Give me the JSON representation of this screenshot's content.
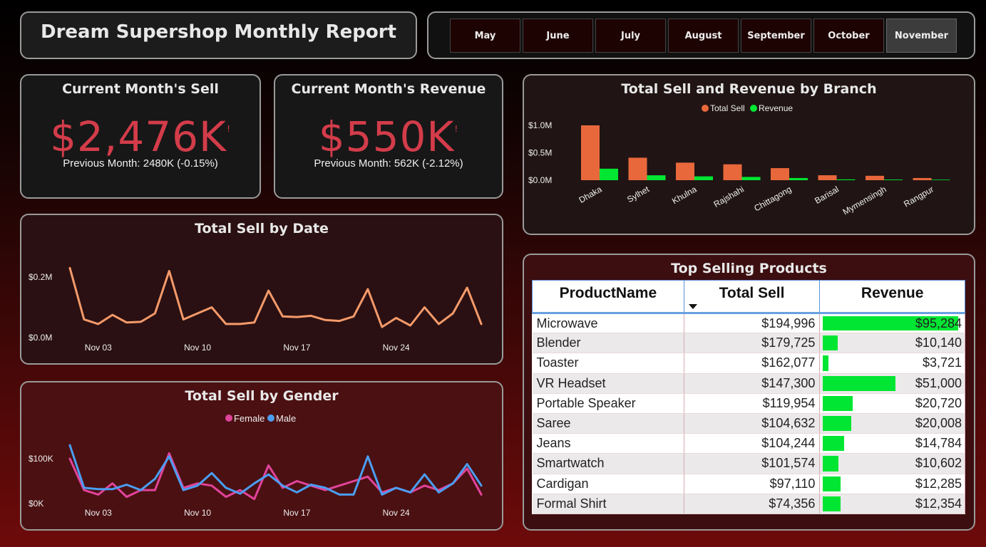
{
  "header": {
    "title": "Dream Supershop Monthly Report"
  },
  "months": [
    {
      "label": "May",
      "active": false
    },
    {
      "label": "June",
      "active": false
    },
    {
      "label": "July",
      "active": false
    },
    {
      "label": "August",
      "active": false
    },
    {
      "label": "September",
      "active": false
    },
    {
      "label": "October",
      "active": false
    },
    {
      "label": "November",
      "active": true
    }
  ],
  "kpis": {
    "sell": {
      "title": "Current Month's Sell",
      "value": "$2,476K",
      "flag": "!",
      "sub": "Previous Month: 2480K (-0.15%)"
    },
    "revenue": {
      "title": "Current Month's Revenue",
      "value": "$550K",
      "flag": "!",
      "sub": "Previous Month: 562K (-2.12%)"
    }
  },
  "colors": {
    "accent_red": "#d33c4a",
    "sell_orange": "#e8683c",
    "revenue_green": "#00e632",
    "line_orange": "#f59a6a",
    "female_pink": "#e0449a",
    "male_blue": "#4a9ef2"
  },
  "charts": {
    "branch": {
      "title": "Total Sell and Revenue by Branch",
      "legend": [
        "Total Sell",
        "Revenue"
      ]
    },
    "date": {
      "title": "Total Sell by Date"
    },
    "gender": {
      "title": "Total Sell by Gender",
      "legend": [
        "Female",
        "Male"
      ]
    }
  },
  "chart_data": [
    {
      "type": "bar",
      "title": "Total Sell and Revenue by Branch",
      "categories": [
        "Dhaka",
        "Sylhet",
        "Khulna",
        "Rajshahi",
        "Chittagong",
        "Barisal",
        "Mymensingh",
        "Rangpur"
      ],
      "series": [
        {
          "name": "Total Sell",
          "values": [
            1.0,
            0.41,
            0.32,
            0.29,
            0.22,
            0.09,
            0.08,
            0.04
          ]
        },
        {
          "name": "Revenue",
          "values": [
            0.21,
            0.09,
            0.07,
            0.06,
            0.04,
            0.015,
            0.012,
            0.01
          ]
        }
      ],
      "ylim": [
        0,
        1.0
      ],
      "yticks": [
        "$0.0M",
        "$0.5M",
        "$1.0M"
      ],
      "legend": "top-center",
      "grid": false
    },
    {
      "type": "line",
      "title": "Total Sell by Date",
      "x": [
        "Nov 01",
        "Nov 02",
        "Nov 03",
        "Nov 04",
        "Nov 05",
        "Nov 06",
        "Nov 07",
        "Nov 08",
        "Nov 09",
        "Nov 10",
        "Nov 11",
        "Nov 12",
        "Nov 13",
        "Nov 14",
        "Nov 15",
        "Nov 16",
        "Nov 17",
        "Nov 18",
        "Nov 19",
        "Nov 20",
        "Nov 21",
        "Nov 22",
        "Nov 23",
        "Nov 24",
        "Nov 25",
        "Nov 26",
        "Nov 27",
        "Nov 28",
        "Nov 29",
        "Nov 30"
      ],
      "xticks": [
        "Nov 03",
        "Nov 10",
        "Nov 17",
        "Nov 24"
      ],
      "series": [
        {
          "name": "Total Sell",
          "values": [
            0.23,
            0.06,
            0.045,
            0.075,
            0.05,
            0.052,
            0.08,
            0.22,
            0.06,
            0.08,
            0.1,
            0.045,
            0.045,
            0.05,
            0.155,
            0.07,
            0.068,
            0.072,
            0.058,
            0.055,
            0.07,
            0.16,
            0.035,
            0.065,
            0.04,
            0.1,
            0.045,
            0.08,
            0.165,
            0.045
          ]
        }
      ],
      "yticks": [
        "$0.0M",
        "$0.2M"
      ],
      "ylim": [
        0,
        0.2
      ],
      "grid": false
    },
    {
      "type": "line",
      "title": "Total Sell by Gender",
      "x": [
        "Nov 01",
        "Nov 02",
        "Nov 03",
        "Nov 04",
        "Nov 05",
        "Nov 06",
        "Nov 07",
        "Nov 08",
        "Nov 09",
        "Nov 10",
        "Nov 11",
        "Nov 12",
        "Nov 13",
        "Nov 14",
        "Nov 15",
        "Nov 16",
        "Nov 17",
        "Nov 18",
        "Nov 19",
        "Nov 20",
        "Nov 21",
        "Nov 22",
        "Nov 23",
        "Nov 24",
        "Nov 25",
        "Nov 26",
        "Nov 27",
        "Nov 28",
        "Nov 29",
        "Nov 30"
      ],
      "xticks": [
        "Nov 03",
        "Nov 10",
        "Nov 17",
        "Nov 24"
      ],
      "series": [
        {
          "name": "Female",
          "values": [
            100,
            30,
            20,
            45,
            15,
            30,
            30,
            112,
            35,
            45,
            40,
            15,
            30,
            10,
            85,
            35,
            50,
            40,
            30,
            40,
            50,
            60,
            25,
            35,
            25,
            40,
            30,
            45,
            78,
            20
          ]
        },
        {
          "name": "Male",
          "values": [
            130,
            35,
            32,
            32,
            42,
            30,
            55,
            105,
            30,
            40,
            68,
            35,
            22,
            45,
            65,
            40,
            25,
            42,
            35,
            20,
            20,
            105,
            20,
            35,
            25,
            65,
            25,
            45,
            88,
            40
          ]
        }
      ],
      "yticks": [
        "$0K",
        "$100K"
      ],
      "ylim": [
        0,
        100
      ],
      "legend": "top-center",
      "grid": false
    },
    {
      "type": "table",
      "title": "Top Selling Products",
      "columns": [
        "ProductName",
        "Total Sell",
        "Revenue"
      ],
      "rows": [
        [
          "Microwave",
          194996,
          95284
        ],
        [
          "Blender",
          179725,
          10140
        ],
        [
          "Toaster",
          162077,
          3721
        ],
        [
          "VR Headset",
          147300,
          51000
        ],
        [
          "Portable Speaker",
          119954,
          20720
        ],
        [
          "Saree",
          104632,
          20008
        ],
        [
          "Jeans",
          104244,
          14784
        ],
        [
          "Smartwatch",
          101574,
          10602
        ],
        [
          "Cardigan",
          97110,
          12285
        ],
        [
          "Formal Shirt",
          74356,
          12354
        ]
      ]
    }
  ],
  "products": {
    "title": "Top Selling Products",
    "columns": [
      "ProductName",
      "Total Sell",
      "Revenue"
    ],
    "rows": [
      {
        "name": "Microwave",
        "sell": "$194,996",
        "revenue": "$95,284",
        "rev_value": 95284
      },
      {
        "name": "Blender",
        "sell": "$179,725",
        "revenue": "$10,140",
        "rev_value": 10140
      },
      {
        "name": "Toaster",
        "sell": "$162,077",
        "revenue": "$3,721",
        "rev_value": 3721
      },
      {
        "name": "VR Headset",
        "sell": "$147,300",
        "revenue": "$51,000",
        "rev_value": 51000
      },
      {
        "name": "Portable Speaker",
        "sell": "$119,954",
        "revenue": "$20,720",
        "rev_value": 20720
      },
      {
        "name": "Saree",
        "sell": "$104,632",
        "revenue": "$20,008",
        "rev_value": 20008
      },
      {
        "name": "Jeans",
        "sell": "$104,244",
        "revenue": "$14,784",
        "rev_value": 14784
      },
      {
        "name": "Smartwatch",
        "sell": "$101,574",
        "revenue": "$10,602",
        "rev_value": 10602
      },
      {
        "name": "Cardigan",
        "sell": "$97,110",
        "revenue": "$12,285",
        "rev_value": 12285
      },
      {
        "name": "Formal Shirt",
        "sell": "$74,356",
        "revenue": "$12,354",
        "rev_value": 12354
      }
    ]
  }
}
